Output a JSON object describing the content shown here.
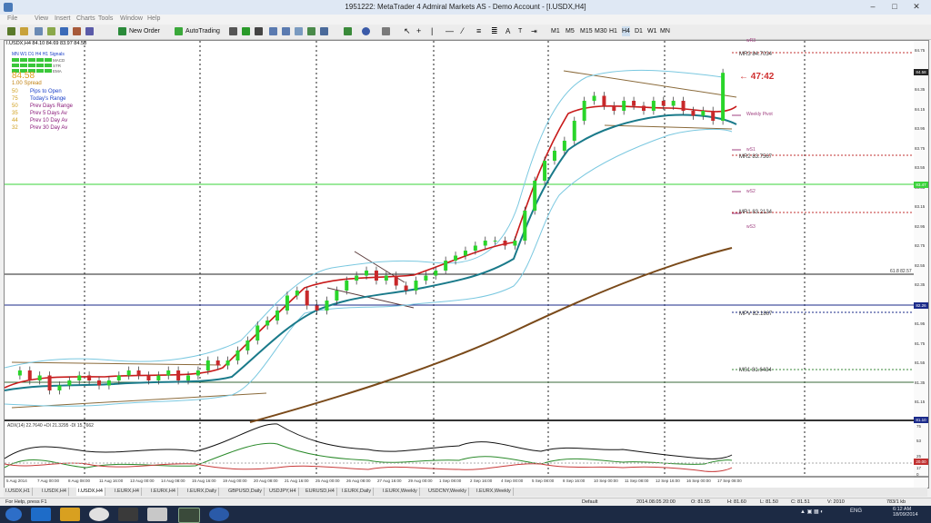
{
  "window": {
    "title": "1951222: MetaTrader 4 Admiral Markets AS - Demo Account - [I.USDX,H4]"
  },
  "menu": [
    "File",
    "View",
    "Insert",
    "Charts",
    "Tools",
    "Window",
    "Help"
  ],
  "toolbar": {
    "new_order": "New Order",
    "autotrading": "AutoTrading",
    "timeframes": [
      "M1",
      "M5",
      "M15",
      "M30",
      "H1",
      "H4",
      "D1",
      "W1",
      "MN"
    ]
  },
  "chart": {
    "symbol_line": "I.USDX,H4  84.10 84.69 83.97 84.58",
    "info_header": [
      "MN",
      "W1",
      "D1",
      "H4",
      "H1",
      "Signals"
    ],
    "info_rows": [
      "MACD",
      "STR",
      "EMA"
    ],
    "price": "84.58",
    "spread": "1.00 Spread",
    "stats": [
      {
        "value": "50",
        "label": "Pips to Open",
        "color": "#1a3fc8"
      },
      {
        "value": "75",
        "label": "Today's Range",
        "color": "#1a3fc8"
      },
      {
        "value": "50",
        "label": "Prev Days Range",
        "color": "#8a1a7a"
      },
      {
        "value": "35",
        "label": "Prev 5 Days Av",
        "color": "#8a1a7a"
      },
      {
        "value": "44",
        "label": "Prev 10 Day Av",
        "color": "#8a1a7a"
      },
      {
        "value": "32",
        "label": "Prev 30 Day Av",
        "color": "#8a1a7a"
      }
    ],
    "countdown": "47:42",
    "pivots": [
      {
        "label": "MR3  84.7034",
        "price": 84.7034
      },
      {
        "label": "MR2  83.7567",
        "price": 83.7567
      },
      {
        "label": "MR1  83.2134",
        "price": 83.2134
      },
      {
        "label": "MPV  82.1867",
        "price": 82.1867
      },
      {
        "label": "MS1  81.6434",
        "price": 81.6434
      }
    ],
    "weekly_labels": [
      "wR3",
      "Weekly Pivot",
      "wS1",
      "wS2",
      "wS3"
    ],
    "fib_label": "61.8  82.57",
    "price_axis": [
      "84.75",
      "84.55",
      "84.35",
      "84.15",
      "83.95",
      "83.75",
      "83.55",
      "83.35",
      "83.15",
      "82.95",
      "82.75",
      "82.55",
      "82.35",
      "82.15",
      "81.95",
      "81.75",
      "81.55",
      "81.35",
      "81.15"
    ],
    "price_tags": [
      "84.58",
      "83.47",
      "82.26",
      "81.10"
    ],
    "time_axis": [
      "5 Aug 2014",
      "7 Aug 00:00",
      "8 Aug 08:00",
      "11 Aug 16:00",
      "13 Aug 00:00",
      "14 Aug 08:00",
      "15 Aug 16:00",
      "19 Aug 00:00",
      "20 Aug 08:00",
      "21 Aug 16:00",
      "25 Aug 00:00",
      "26 Aug 08:00",
      "27 Aug 16:00",
      "29 Aug 00:00",
      "1 Sep 08:00",
      "2 Sep 16:00",
      "4 Sep 00:00",
      "5 Sep 08:00",
      "8 Sep 16:00",
      "10 Sep 00:00",
      "11 Sep 08:00",
      "12 Sep 16:00",
      "16 Sep 00:00",
      "17 Sep 08:00"
    ],
    "adx_label": "ADX(14) 22.7640 +DI 21.3295 -DI 15.7662",
    "adx_axis": [
      "75",
      "53",
      "25",
      "17",
      "0"
    ],
    "adx_tag": "20.00"
  },
  "chart_data": {
    "type": "line",
    "ylim": [
      81.1,
      84.9
    ],
    "series": [
      {
        "name": "I.USDX,H4",
        "values": [
          81.55,
          81.6,
          81.5,
          81.55,
          81.4,
          81.45,
          81.5,
          81.55,
          81.5,
          81.45,
          81.5,
          81.55,
          81.6,
          81.55,
          81.5,
          81.55,
          81.6,
          81.5,
          81.55,
          81.6,
          81.7,
          81.65,
          81.7,
          81.8,
          81.9,
          82.05,
          82.1,
          82.2,
          82.35,
          82.4,
          82.25,
          82.2,
          82.3,
          82.4,
          82.5,
          82.55,
          82.6,
          82.5,
          82.55,
          82.45,
          82.4,
          82.5,
          82.55,
          82.6,
          82.7,
          82.75,
          82.8,
          82.85,
          82.9,
          82.9,
          82.85,
          82.9,
          83.2,
          83.5,
          83.7,
          83.8,
          83.9,
          84.1,
          84.3,
          84.35,
          84.25,
          84.2,
          84.3,
          84.25,
          84.2,
          84.3,
          84.25,
          84.3,
          84.2,
          84.15,
          84.2,
          84.1,
          84.58
        ]
      }
    ]
  }
}
